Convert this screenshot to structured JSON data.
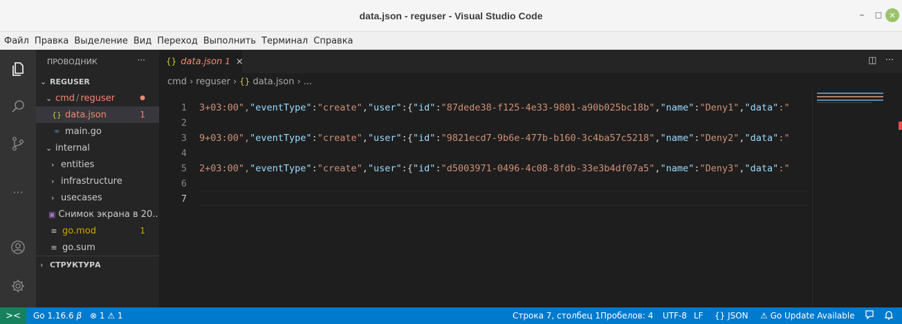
{
  "window": {
    "title": "data.json - reguser - Visual Studio Code",
    "minimize": "–",
    "maximize": "□",
    "close": "×"
  },
  "menu": [
    "Файл",
    "Правка",
    "Выделение",
    "Вид",
    "Переход",
    "Выполнить",
    "Терминал",
    "Справка"
  ],
  "activity_bar": [
    "files-icon",
    "search-icon",
    "source-control-icon",
    "more-icon",
    "account-icon",
    "settings-gear-icon"
  ],
  "sidebar": {
    "header": "ПРОВОДНИК",
    "more": "···",
    "root": "REGUSER",
    "cmd_folder": "cmd",
    "cmd_sep": "/",
    "cmd_sub": "reguser",
    "cmd_dot": "●",
    "data_json": "data.json",
    "data_json_badge": "1",
    "main_go": "main.go",
    "internal": "internal",
    "entities": "entities",
    "infrastructure": "infrastructure",
    "usecases": "usecases",
    "screenshot": "Снимок экрана в 20...",
    "go_mod": "go.mod",
    "go_mod_badge": "1",
    "go_sum": "go.sum",
    "outline": "СТРУКТУРА"
  },
  "tab": {
    "icon": "{}",
    "name": "data.json",
    "problems": "1",
    "close": "×"
  },
  "breadcrumb": {
    "cmd": "cmd",
    "reguser": "reguser",
    "icon": "{}",
    "file": "data.json",
    "more": "..."
  },
  "code": {
    "lines": [
      {
        "n": "1",
        "a": "3+03:00\",",
        "b": "\"eventType\"",
        "c": ":",
        "d": "\"create\"",
        "e": ",",
        "f": "\"user\"",
        "g": ":{",
        "h": "\"id\"",
        "i": ":",
        "j": "\"87dede38-f125-4e33-9801-a90b025bc18b\"",
        "k": ",",
        "l": "\"name\"",
        "m": ":",
        "o": "\"Deny1\"",
        "q": ",",
        "r": "\"data\"",
        "s": ":\""
      },
      {
        "n": "2"
      },
      {
        "n": "3",
        "a": "9+03:00\",",
        "b": "\"eventType\"",
        "c": ":",
        "d": "\"create\"",
        "e": ",",
        "f": "\"user\"",
        "g": ":{",
        "h": "\"id\"",
        "i": ":",
        "j": "\"9821ecd7-9b6e-477b-b160-3c4ba57c5218\"",
        "k": ",",
        "l": "\"name\"",
        "m": ":",
        "o": "\"Deny2\"",
        "q": ",",
        "r": "\"data\"",
        "s": ":\""
      },
      {
        "n": "4"
      },
      {
        "n": "5",
        "a": "2+03:00\",",
        "b": "\"eventType\"",
        "c": ":",
        "d": "\"create\"",
        "e": ",",
        "f": "\"user\"",
        "g": ":{",
        "h": "\"id\"",
        "i": ":",
        "j": "\"d5003971-0496-4c08-8fdb-33e3b4df07a5\"",
        "k": ",",
        "l": "\"name\"",
        "m": ":",
        "o": "\"Deny3\"",
        "q": ",",
        "r": "\"data\"",
        "s": ":\""
      },
      {
        "n": "6"
      },
      {
        "n": "7"
      }
    ]
  },
  "status": {
    "remote_icon": "><",
    "go_version": "Go 1.16.6",
    "go_icon": "β",
    "errors": "⊗ 1",
    "warnings": "⚠ 1",
    "position": "Строка 7, столбец 1",
    "spaces": "Пробелов: 4",
    "encoding": "UTF-8",
    "eol": "LF",
    "language": "{} JSON",
    "update": "⚠ Go Update Available",
    "feedback_icon": "feedback-icon",
    "bell_icon": "bell-icon"
  },
  "colors": {
    "status_bar": "#007acc",
    "remote": "#16825d",
    "error": "#f48771",
    "modified": "#e2c08d",
    "json_key": "#9cdcfe",
    "json_string": "#ce9178"
  }
}
